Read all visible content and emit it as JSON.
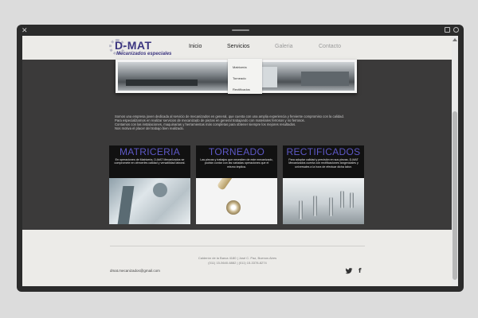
{
  "header": {
    "logo_title": "D-MAT",
    "logo_subtitle": "Mecanizados especiales",
    "nav": [
      "Inicio",
      "Servicios",
      "Galeria",
      "Contacto"
    ]
  },
  "dropdown": [
    "Matriceria",
    "Torneado",
    "Rectificados"
  ],
  "intro": [
    "Somos una empresa joven dedicada al servicio de mecanizados en general, que cuenta con una amplia experiencia y ferviente compromiso con la calidad.",
    "Para especializarnos en realizar servicios de mecanizado de piezas en general trabajando con materiales ferrosos y no ferrosos.",
    "Contamos con las instalaciones, maquinarias y herramientas más completas para obtener siempre los mejores resultados.",
    "Nos motiva el placer del trabajo bien realizado."
  ],
  "cards": [
    {
      "title": "MATRICERIA",
      "text": "En operaciones de Matriceria, D-MAT Mecanizados se compromete en ofrecerles calidad y versatilidad laboral."
    },
    {
      "title": "TORNEADO",
      "text": "Las piezas y trabajos que necesiten de este mecanizado, podrán contar con las variadas operaciones que el mismo implica."
    },
    {
      "title": "RECTIFICADOS",
      "text": "Para adoptar calidad y precisión en sus piezas, D-MAT Mecanizados cuenta con rectificaciones tangenciales y universales a la hora de efectuar dicha labor."
    }
  ],
  "footer": {
    "address_line1": "Calderón de la Barca 4180 | José C. Paz, Buenos Aires",
    "address_line2": "(011) 15-5640-6882 | (011) 15-3378-8274",
    "email": "dmat.mecanizados@gmail.com"
  },
  "icons": {
    "social": [
      "twitter-icon",
      "facebook-icon"
    ]
  },
  "colors": {
    "brand": "#3b3580",
    "card_title": "#5d58c6"
  }
}
